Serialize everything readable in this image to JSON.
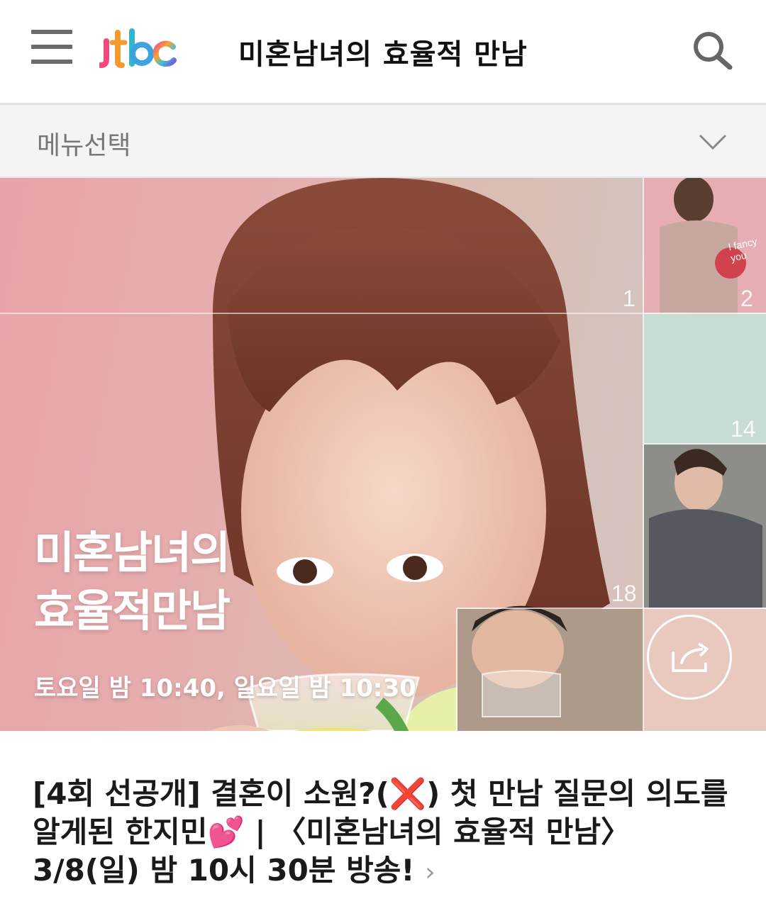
{
  "header": {
    "menu_icon": "hamburger-menu-icon",
    "logo_text": "jtbc",
    "title": "미혼남녀의 효율적 만남",
    "search_icon": "search-icon"
  },
  "menu_select": {
    "label": "메뉴선택",
    "icon": "chevron-down-icon"
  },
  "banner": {
    "title_line1": "미혼남녀의",
    "title_line2": "효율적만남",
    "schedule": "토요일 밤 10:40, 일요일 밤 10:30",
    "tile_numbers": [
      "1",
      "2",
      "14",
      "18"
    ],
    "tile_caption": "I fancy you",
    "share_icon": "share-icon"
  },
  "headline": {
    "text": "[4회 선공개] 결혼이 소원?(❌) 첫 만남 질문의 의도를 알게된 한지민💕 | 〈미혼남녀의 효율적 만남〉 3/8(일) 밤 10시 30분 방송!",
    "arrow": "›"
  },
  "colors": {
    "title_text": "#111111",
    "menu_bg": "#f4f4f4",
    "menu_text": "#777777",
    "banner_pink": "#e7a6ab",
    "banner_mint": "#c8d6c8"
  }
}
